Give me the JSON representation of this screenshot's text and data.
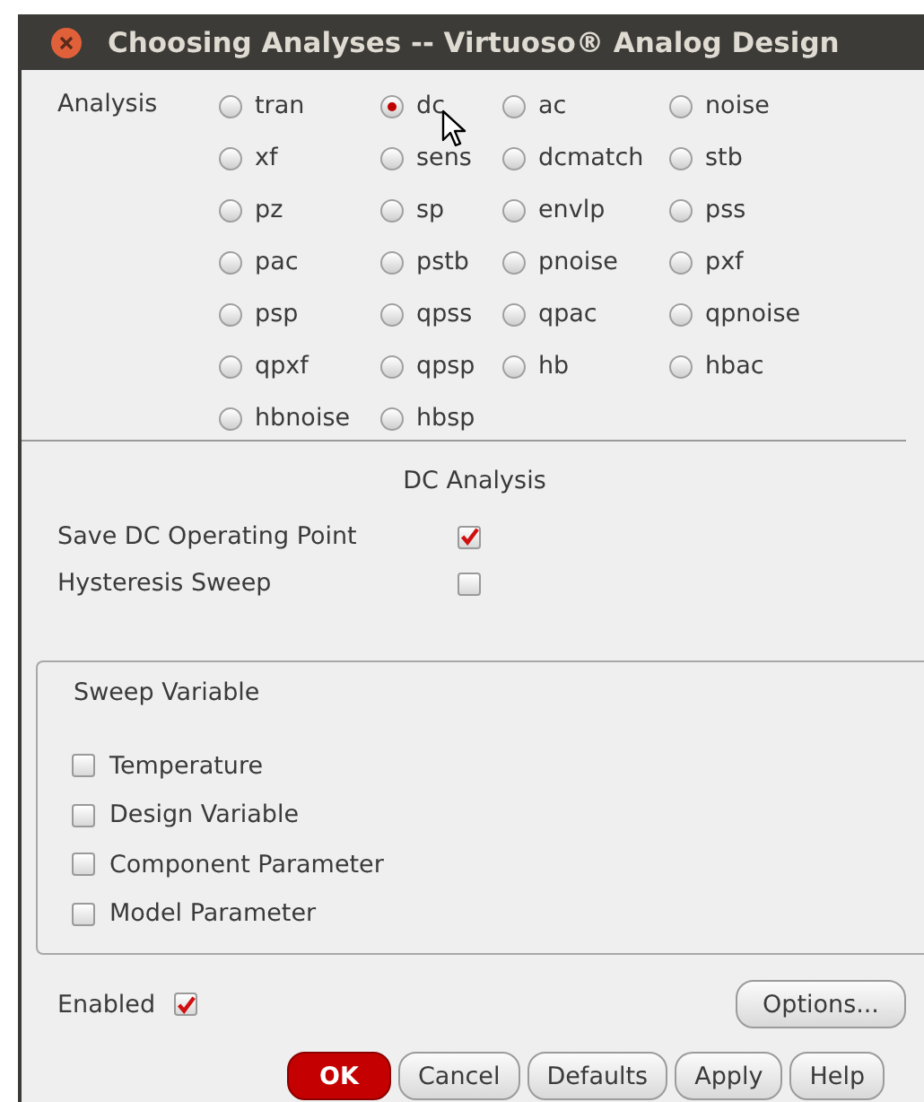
{
  "window": {
    "title": "Choosing Analyses -- Virtuoso® Analog Design"
  },
  "analysis": {
    "label": "Analysis",
    "options": [
      {
        "label": "tran",
        "selected": false
      },
      {
        "label": "dc",
        "selected": true
      },
      {
        "label": "ac",
        "selected": false
      },
      {
        "label": "noise",
        "selected": false
      },
      {
        "label": "xf",
        "selected": false
      },
      {
        "label": "sens",
        "selected": false
      },
      {
        "label": "dcmatch",
        "selected": false
      },
      {
        "label": "stb",
        "selected": false
      },
      {
        "label": "pz",
        "selected": false
      },
      {
        "label": "sp",
        "selected": false
      },
      {
        "label": "envlp",
        "selected": false
      },
      {
        "label": "pss",
        "selected": false
      },
      {
        "label": "pac",
        "selected": false
      },
      {
        "label": "pstb",
        "selected": false
      },
      {
        "label": "pnoise",
        "selected": false
      },
      {
        "label": "pxf",
        "selected": false
      },
      {
        "label": "psp",
        "selected": false
      },
      {
        "label": "qpss",
        "selected": false
      },
      {
        "label": "qpac",
        "selected": false
      },
      {
        "label": "qpnoise",
        "selected": false
      },
      {
        "label": "qpxf",
        "selected": false
      },
      {
        "label": "qpsp",
        "selected": false
      },
      {
        "label": "hb",
        "selected": false
      },
      {
        "label": "hbac",
        "selected": false
      },
      {
        "label": "hbnoise",
        "selected": false
      },
      {
        "label": "hbsp",
        "selected": false
      }
    ]
  },
  "dc_analysis": {
    "title": "DC Analysis",
    "options": [
      {
        "label": "Save DC Operating Point",
        "checked": true
      },
      {
        "label": "Hysteresis Sweep",
        "checked": false
      }
    ]
  },
  "sweep_variable": {
    "title": "Sweep Variable",
    "options": [
      {
        "label": "Temperature",
        "checked": false
      },
      {
        "label": "Design Variable",
        "checked": false
      },
      {
        "label": "Component Parameter",
        "checked": false
      },
      {
        "label": "Model Parameter",
        "checked": false
      }
    ]
  },
  "enabled": {
    "label": "Enabled",
    "checked": true
  },
  "options_button": "Options...",
  "buttons": [
    {
      "label": "OK",
      "kind": "default"
    },
    {
      "label": "Cancel",
      "kind": "normal"
    },
    {
      "label": "Defaults",
      "kind": "normal"
    },
    {
      "label": "Apply",
      "kind": "normal"
    },
    {
      "label": "Help",
      "kind": "normal"
    }
  ]
}
